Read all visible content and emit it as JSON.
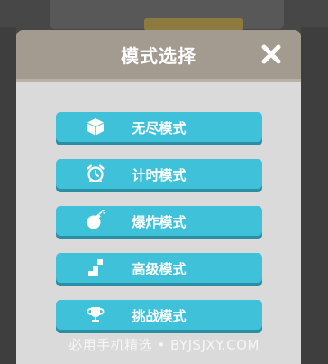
{
  "dialog": {
    "title": "模式选择",
    "close_icon": "close-icon"
  },
  "modes": [
    {
      "label": "无尽模式",
      "icon": "cube-icon"
    },
    {
      "label": "计时模式",
      "icon": "alarm-clock-icon"
    },
    {
      "label": "爆炸模式",
      "icon": "bomb-icon"
    },
    {
      "label": "高级模式",
      "icon": "stairs-icon"
    },
    {
      "label": "挑战模式",
      "icon": "trophy-icon"
    }
  ],
  "watermark": "必用手机精选 • BYJSJXY.COM",
  "colors": {
    "header": "#a39a90",
    "panel": "#dadada",
    "button": "#3fc1d9",
    "button_shadow": "#2a8fa4"
  }
}
